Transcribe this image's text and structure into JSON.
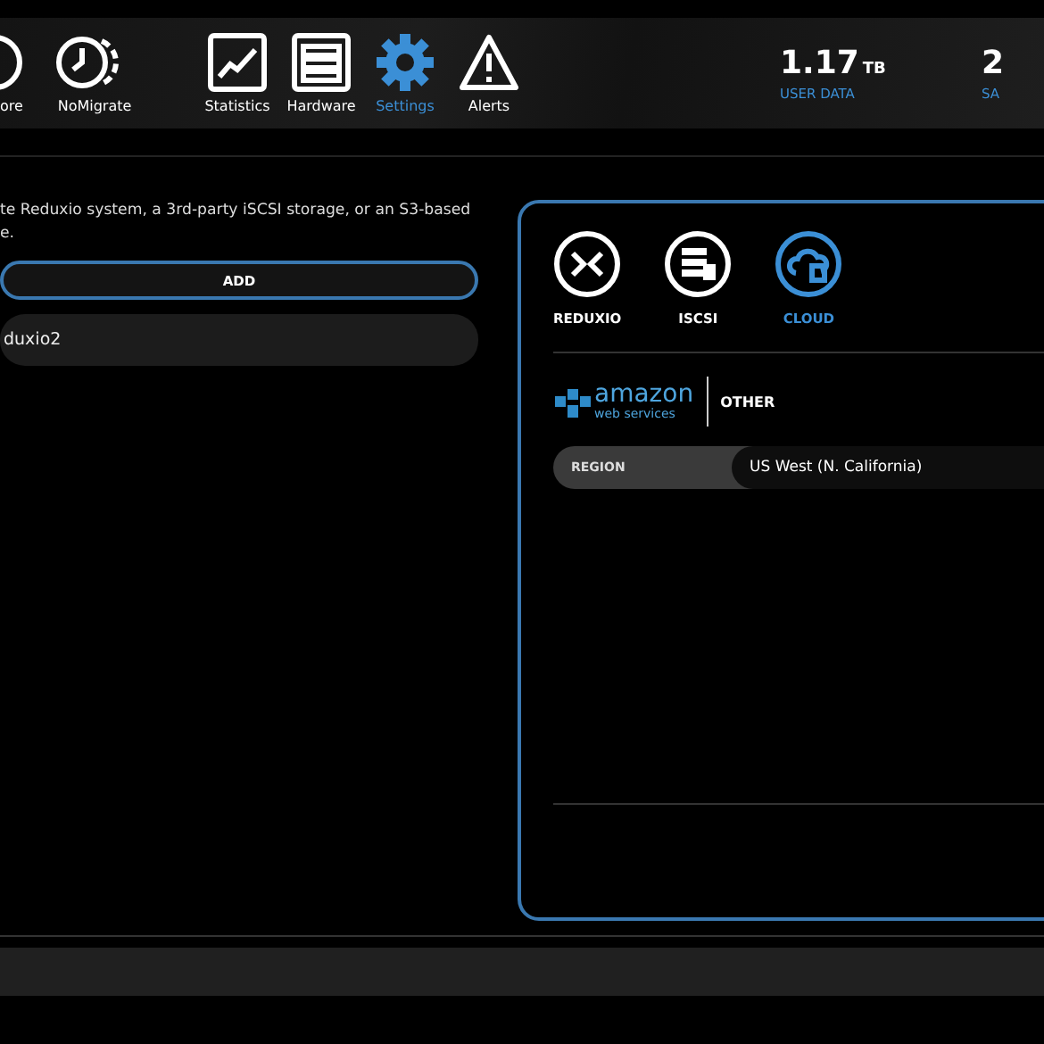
{
  "nav": [
    {
      "label": "ore",
      "selected": false
    },
    {
      "label": "NoMigrate",
      "selected": false
    },
    {
      "label": "Statistics",
      "selected": false
    },
    {
      "label": "Hardware",
      "selected": false
    },
    {
      "label": "Settings",
      "selected": true
    },
    {
      "label": "Alerts",
      "selected": false
    }
  ],
  "stats": [
    {
      "value": "1.17",
      "unit": "TB",
      "label": "USER DATA"
    },
    {
      "value": "2",
      "label": "SA"
    }
  ],
  "storage": {
    "description": [
      "te Reduxio system, a 3rd-party iSCSI storage, or an S3-based",
      "e."
    ],
    "add_button": "ADD",
    "items": [
      "duxio2"
    ]
  },
  "target_panel": {
    "types": [
      {
        "label": "REDUXIO",
        "selected": false
      },
      {
        "label": "ISCSI",
        "selected": false
      },
      {
        "label": "CLOUD",
        "selected": true
      }
    ],
    "providers": [
      {
        "kind": "logo",
        "name": "amazon",
        "subtitle": "web services"
      },
      {
        "kind": "text",
        "name": "OTHER"
      }
    ],
    "region": {
      "label": "REGION",
      "value": "US West (N. California)"
    }
  }
}
